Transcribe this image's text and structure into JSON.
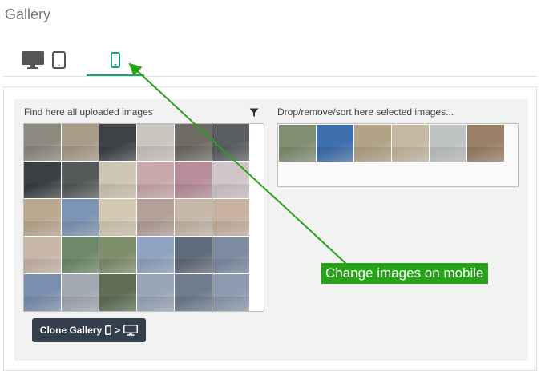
{
  "page": {
    "title": "Gallery"
  },
  "tabs": [
    {
      "name": "desktop",
      "icon": "desktop-icon",
      "active": false
    },
    {
      "name": "tablet",
      "icon": "tablet-icon",
      "active": false
    },
    {
      "name": "mobile",
      "icon": "mobile-icon",
      "active": true
    }
  ],
  "uploaded": {
    "label": "Find here all uploaded images",
    "filter_icon": "filter-icon",
    "thumbnails": [
      "#8e8a80",
      "#a89c88",
      "#3e4246",
      "#c9c6c0",
      "#6f6a63",
      "#5a5e63",
      "#3b3f41",
      "#56595a",
      "#cfc5b3",
      "#c9a9a7",
      "#b88e9a",
      "#d2c5c9",
      "#bba98f",
      "#7d95b4",
      "#d3c9b3",
      "#b4a099",
      "#c6b7a8",
      "#c7b3a0",
      "#c8b6a8",
      "#6f8a6a",
      "#7f8f6b",
      "#8ea3bf",
      "#5f6a7a",
      "#7d8aa0",
      "#7a8fb0",
      "#a3a9b3",
      "#5f6f55",
      "#9aa6b8",
      "#6f7c8e",
      "#8e9bb0"
    ]
  },
  "selected": {
    "label": "Drop/remove/sort here selected images...",
    "thumbnails": [
      "#7f8f70",
      "#3e6fae",
      "#b2a387",
      "#c6b9a2",
      "#bfc2c3",
      "#9a8066"
    ]
  },
  "clone_button": {
    "label": "Clone Gallery",
    "separator": ">",
    "from_icon": "mobile-icon",
    "to_icon": "desktop-icon"
  },
  "annotation": {
    "text": "Change images on mobile",
    "color": "#27a318"
  },
  "colors": {
    "accent": "#1aa37a",
    "button_bg": "#343f4d",
    "panel_bg": "#f2f2f2"
  }
}
